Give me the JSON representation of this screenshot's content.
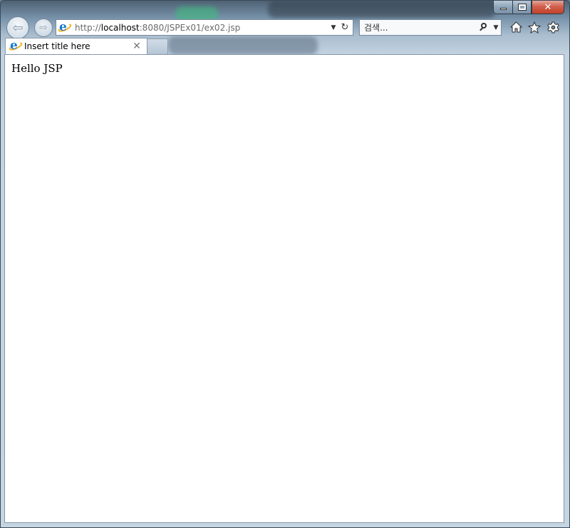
{
  "browser": {
    "address": {
      "scheme": "http://",
      "host": "localhost",
      "path": ":8080/JSPEx01/ex02.jsp"
    },
    "search": {
      "placeholder": "검색..."
    },
    "tab": {
      "title": "Insert title here"
    },
    "icons": {
      "back": "back-arrow-icon",
      "forward": "forward-arrow-icon",
      "refresh": "refresh-icon",
      "search": "search-icon",
      "home": "home-icon",
      "favorites": "star-icon",
      "tools": "gear-icon",
      "close": "close-icon"
    }
  },
  "page": {
    "text": "Hello JSP"
  }
}
